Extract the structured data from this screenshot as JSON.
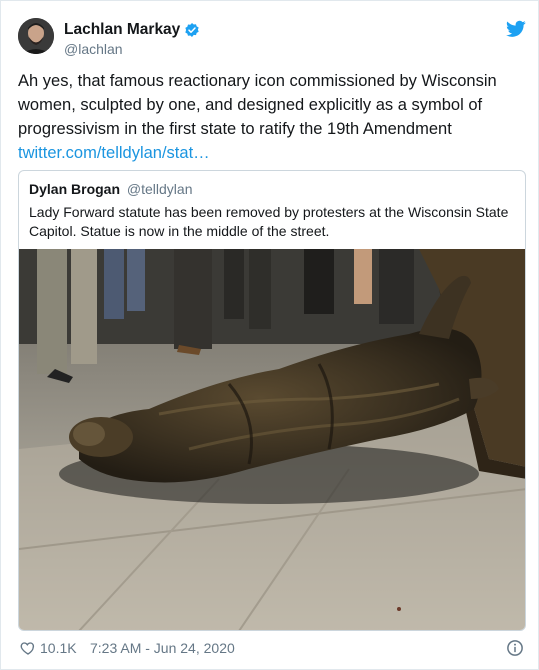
{
  "tweet": {
    "author_name": "Lachlan Markay",
    "author_handle": "@lachlan",
    "text": "Ah yes, that famous reactionary icon commissioned by Wisconsin women, sculpted by one, and designed explicitly as a symbol of progressivism in the first state to ratify the 19th Amendment",
    "link_text": "twitter.com/telldylan/stat…",
    "likes": "10.1K",
    "timestamp": "7:23 AM - Jun 24, 2020"
  },
  "quoted_tweet": {
    "author_name": "Dylan Brogan",
    "author_handle": "@telldylan",
    "text": "Lady Forward statute has been removed by protesters at the Wisconsin State Capitol. Statue is now in the middle of the street."
  },
  "icons": {
    "verified": "verified-badge-icon",
    "brand": "twitter-bird-icon",
    "like": "heart-icon",
    "info": "info-icon"
  },
  "colors": {
    "link": "#1b95e0",
    "secondary_text": "#657786",
    "border": "#ccd6dd"
  }
}
